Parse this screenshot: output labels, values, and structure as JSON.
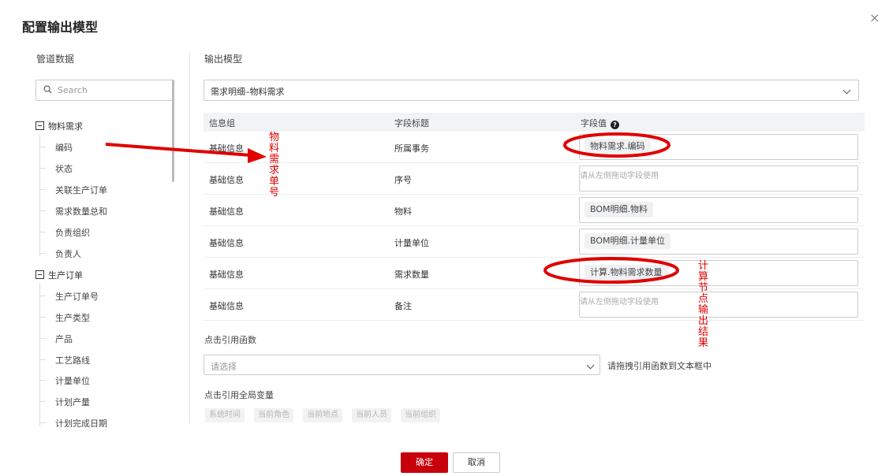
{
  "dialog": {
    "title": "配置输出模型",
    "close_label": "×"
  },
  "left": {
    "title": "管道数据",
    "search_placeholder": "Search",
    "groups": [
      {
        "label": "物料需求",
        "items": [
          "编码",
          "状态",
          "关联生产订单",
          "需求数量总和",
          "负责组织",
          "负责人"
        ]
      },
      {
        "label": "生产订单",
        "items": [
          "生产订单号",
          "生产类型",
          "产品",
          "工艺路线",
          "计量单位",
          "计划产量",
          "计划完成日期"
        ]
      }
    ]
  },
  "right": {
    "title": "输出模型",
    "model_select": "需求明细–物料需求",
    "columns": [
      "信息组",
      "字段标题",
      "字段值"
    ],
    "help_icon": "?",
    "rows": [
      {
        "group": "基础信息",
        "field": "所属事务",
        "value": "物料需求.编码",
        "placeholder": ""
      },
      {
        "group": "基础信息",
        "field": "序号",
        "value": "",
        "placeholder": "请从左侧拖动字段使用"
      },
      {
        "group": "基础信息",
        "field": "物料",
        "value": "BOM明细.物料",
        "placeholder": ""
      },
      {
        "group": "基础信息",
        "field": "计量单位",
        "value": "BOM明细.计量单位",
        "placeholder": ""
      },
      {
        "group": "基础信息",
        "field": "需求数量",
        "value": "计算.物料需求数量",
        "placeholder": ""
      },
      {
        "group": "基础信息",
        "field": "备注",
        "value": "",
        "placeholder": "请从左侧拖动字段使用"
      }
    ],
    "function_label": "点击引用函数",
    "function_placeholder": "请选择",
    "function_hint": "请拖拽引用函数到文本框中",
    "globals_label": "点击引用全局变量",
    "globals": [
      "系统时间",
      "当前角色",
      "当前地点",
      "当前人员",
      "当前组织"
    ]
  },
  "buttons": {
    "ok": "确定",
    "cancel": "取消"
  },
  "annotations": {
    "left_note": "物料需求单号",
    "right_note": "计算节点输出结果",
    "color": "#e00000"
  },
  "colors": {
    "primary": "#c7000b",
    "header_bg": "#f2f3f5"
  }
}
